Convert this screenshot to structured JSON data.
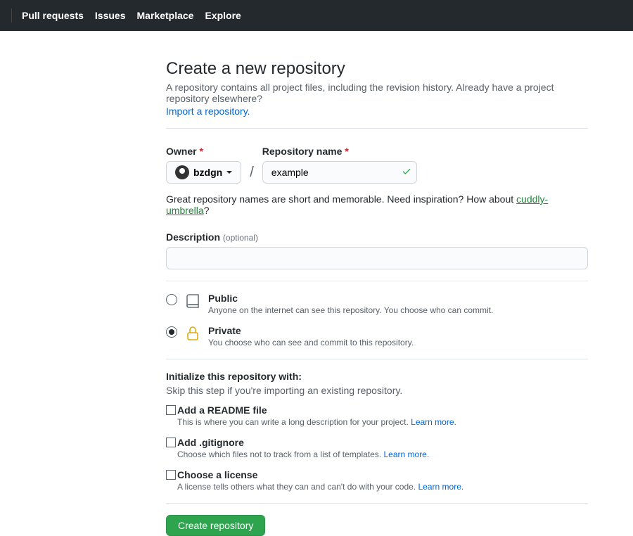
{
  "nav": {
    "pull_requests": "Pull requests",
    "issues": "Issues",
    "marketplace": "Marketplace",
    "explore": "Explore"
  },
  "page": {
    "title": "Create a new repository",
    "subtitle": "A repository contains all project files, including the revision history. Already have a project repository elsewhere?",
    "import_link": "Import a repository."
  },
  "owner": {
    "label": "Owner",
    "value": "bzdgn"
  },
  "repo": {
    "label": "Repository name",
    "value": "example"
  },
  "hint": {
    "text_a": "Great repository names are short and memorable. Need inspiration? How about ",
    "suggestion": "cuddly-umbrella",
    "q": "?"
  },
  "description": {
    "label": "Description",
    "optional": "(optional)",
    "value": ""
  },
  "visibility": {
    "public": {
      "title": "Public",
      "desc": "Anyone on the internet can see this repository. You choose who can commit."
    },
    "private": {
      "title": "Private",
      "desc": "You choose who can see and commit to this repository."
    }
  },
  "init": {
    "title": "Initialize this repository with:",
    "subtitle": "Skip this step if you're importing an existing repository.",
    "readme": {
      "label": "Add a README file",
      "desc": "This is where you can write a long description for your project. ",
      "learn": "Learn more."
    },
    "gitignore": {
      "label": "Add .gitignore",
      "desc": "Choose which files not to track from a list of templates. ",
      "learn": "Learn more."
    },
    "license": {
      "label": "Choose a license",
      "desc": "A license tells others what they can and can't do with your code. ",
      "learn": "Learn more."
    }
  },
  "submit": {
    "label": "Create repository"
  }
}
